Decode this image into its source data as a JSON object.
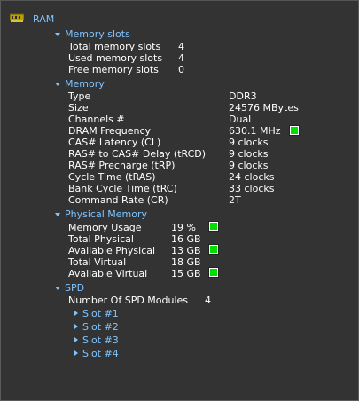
{
  "root": {
    "label": "RAM",
    "icon": "ram-module-icon"
  },
  "memory_slots": {
    "title": "Memory slots",
    "rows": [
      {
        "label": "Total memory slots",
        "value": "4"
      },
      {
        "label": "Used memory slots",
        "value": "4"
      },
      {
        "label": "Free memory slots",
        "value": "0"
      }
    ]
  },
  "memory": {
    "title": "Memory",
    "rows": [
      {
        "label": "Type",
        "value": "DDR3"
      },
      {
        "label": "Size",
        "value": "24576 MBytes"
      },
      {
        "label": "Channels #",
        "value": "Dual"
      },
      {
        "label": "DRAM Frequency",
        "value": "630.1 MHz"
      },
      {
        "label": "CAS# Latency (CL)",
        "value": "9 clocks"
      },
      {
        "label": "RAS# to CAS# Delay (tRCD)",
        "value": "9 clocks"
      },
      {
        "label": "RAS# Precharge (tRP)",
        "value": "9 clocks"
      },
      {
        "label": "Cycle Time (tRAS)",
        "value": "24 clocks"
      },
      {
        "label": "Bank Cycle Time (tRC)",
        "value": "33 clocks"
      },
      {
        "label": "Command Rate (CR)",
        "value": "2T"
      }
    ]
  },
  "physical_memory": {
    "title": "Physical Memory",
    "rows": [
      {
        "label": "Memory Usage",
        "value": "19 %"
      },
      {
        "label": "Total Physical",
        "value": "16 GB"
      },
      {
        "label": "Available Physical",
        "value": "13 GB"
      },
      {
        "label": "Total Virtual",
        "value": "18 GB"
      },
      {
        "label": "Available Virtual",
        "value": "15 GB"
      }
    ]
  },
  "spd": {
    "title": "SPD",
    "modules_label": "Number Of SPD Modules",
    "modules_value": "4",
    "slots": [
      "Slot #1",
      "Slot #2",
      "Slot #3",
      "Slot #4"
    ]
  },
  "colors": {
    "background": "#333333",
    "section_title": "#7fc4ff",
    "text": "#ffffff",
    "indicator": "#00dd00"
  }
}
